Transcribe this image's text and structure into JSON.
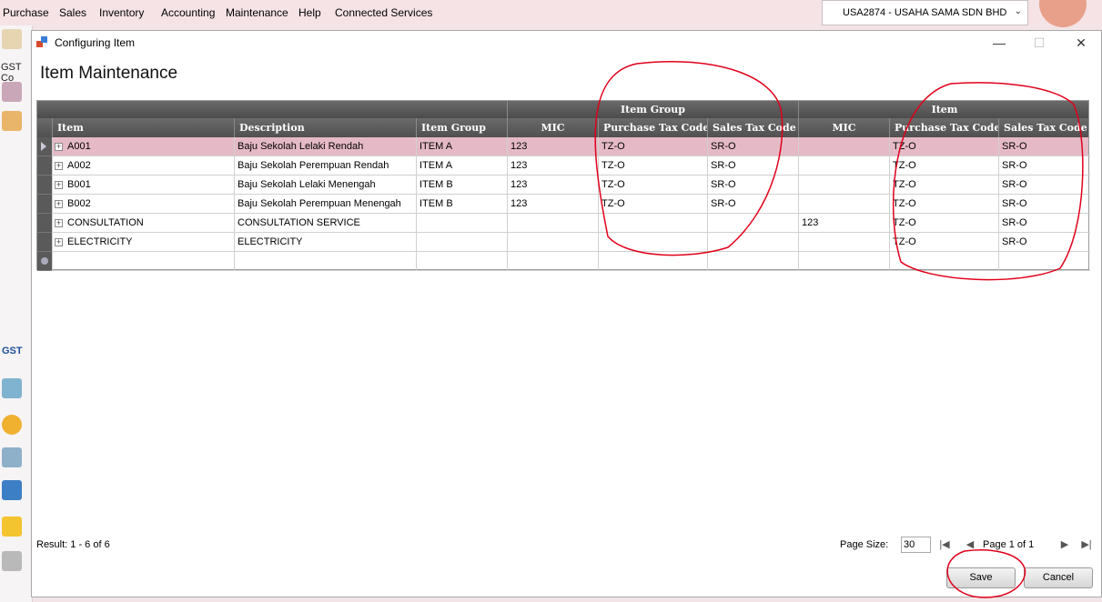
{
  "background_app": {
    "menu": [
      "Purchase",
      "Sales",
      "Inventory",
      "Accounting",
      "Maintenance",
      "Help",
      "Connected Services"
    ],
    "company": "USA2874 - USAHA SAMA SDN BHD",
    "sidebar_label_gst": "GST Co",
    "sidebar_gst_badge": "GST"
  },
  "dialog": {
    "title": "Configuring Item",
    "heading": "Item Maintenance",
    "window_controls": {
      "minimize": "—",
      "maximize": "☐",
      "close": "✕"
    }
  },
  "grid": {
    "bands": [
      "Item Group",
      "Item"
    ],
    "columns": [
      "Item",
      "Description",
      "Item Group",
      "MIC",
      "Purchase Tax Code",
      "Sales Tax Code",
      "MIC",
      "Purchase Tax Code",
      "Sales Tax Code"
    ],
    "rows": [
      [
        "A001",
        "Baju Sekolah Lelaki Rendah",
        "ITEM A",
        "123",
        "TZ-O",
        "SR-O",
        "",
        "TZ-O",
        "SR-O"
      ],
      [
        "A002",
        "Baju Sekolah Perempuan Rendah",
        "ITEM A",
        "123",
        "TZ-O",
        "SR-O",
        "",
        "TZ-O",
        "SR-O"
      ],
      [
        "B001",
        "Baju Sekolah Lelaki Menengah",
        "ITEM B",
        "123",
        "TZ-O",
        "SR-O",
        "",
        "TZ-O",
        "SR-O"
      ],
      [
        "B002",
        "Baju Sekolah Perempuan Menengah",
        "ITEM B",
        "123",
        "TZ-O",
        "SR-O",
        "",
        "TZ-O",
        "SR-O"
      ],
      [
        "CONSULTATION",
        "CONSULTATION SERVICE",
        "",
        "",
        "",
        "",
        "123",
        "TZ-O",
        "SR-O"
      ],
      [
        "ELECTRICITY",
        "ELECTRICITY",
        "",
        "",
        "",
        "",
        "",
        "TZ-O",
        "SR-O"
      ]
    ],
    "selected_row": 0
  },
  "footer": {
    "result": "Result: 1 - 6 of 6",
    "page_size_label": "Page Size:",
    "page_size_value": "30",
    "page_label": "Page 1 of 1",
    "save": "Save",
    "cancel": "Cancel"
  },
  "annotation_color": "#e0001a"
}
